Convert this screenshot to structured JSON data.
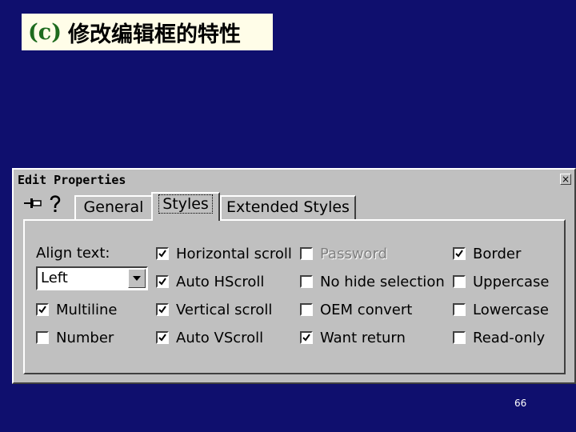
{
  "caption": {
    "tag": "(c)",
    "text": "修改编辑框的特性"
  },
  "dialog": {
    "title": "Edit Properties",
    "close_glyph": "×",
    "tabs": [
      {
        "label": "General",
        "active": false
      },
      {
        "label": "Styles",
        "active": true
      },
      {
        "label": "Extended Styles",
        "active": false
      }
    ],
    "align": {
      "label": "Align text:",
      "value": "Left"
    },
    "checkboxes": {
      "multiline": {
        "label": "Multiline",
        "checked": true
      },
      "number": {
        "label": "Number",
        "checked": false
      },
      "horizontal_scroll": {
        "label": "Horizontal scroll",
        "checked": true
      },
      "auto_hscroll": {
        "label": "Auto HScroll",
        "checked": true
      },
      "vertical_scroll": {
        "label": "Vertical scroll",
        "checked": true
      },
      "auto_vscroll": {
        "label": "Auto VScroll",
        "checked": true
      },
      "password": {
        "label": "Password",
        "checked": false,
        "disabled": true
      },
      "no_hide_selection": {
        "label": "No hide selection",
        "checked": false
      },
      "oem_convert": {
        "label": "OEM convert",
        "checked": false
      },
      "want_return": {
        "label": "Want return",
        "checked": true
      },
      "border": {
        "label": "Border",
        "checked": true
      },
      "uppercase": {
        "label": "Uppercase",
        "checked": false
      },
      "lowercase": {
        "label": "Lowercase",
        "checked": false
      },
      "read_only": {
        "label": "Read-only",
        "checked": false
      }
    }
  },
  "page_number": "66",
  "colors": {
    "background": "#0f0f6e",
    "dialog": "#c0c0c0",
    "caption_bg": "#fffde8",
    "caption_tag": "#1e6b1e"
  }
}
